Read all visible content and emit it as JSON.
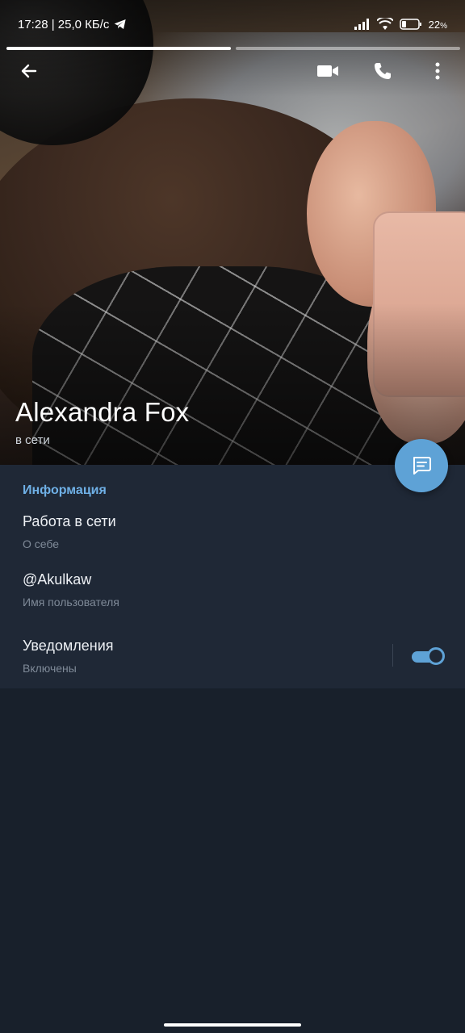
{
  "status_bar": {
    "time_speed": "17:28 | 25,0 КБ/с",
    "battery": "22",
    "battery_unit": "%",
    "signal_icon": "signal-icon",
    "wifi_icon": "wifi-icon",
    "battery_icon": "battery-icon",
    "telegram_icon": "telegram-icon"
  },
  "story_progress": {
    "segments": 2,
    "active_index": 0
  },
  "top_bar": {
    "back_icon": "back-arrow-icon",
    "video_icon": "video-call-icon",
    "call_icon": "phone-call-icon",
    "menu_icon": "more-vertical-icon"
  },
  "profile": {
    "name": "Alexandra Fox",
    "status": "в сети"
  },
  "fab": {
    "icon": "message-icon"
  },
  "info": {
    "header": "Информация",
    "about": {
      "value": "Работа в сети",
      "label": "О себе"
    },
    "username": {
      "value": "@Akulkaw",
      "label": "Имя пользователя"
    },
    "notifications": {
      "value": "Уведомления",
      "label": "Включены",
      "enabled": true
    }
  },
  "colors": {
    "accent": "#5ea2d6",
    "header_accent": "#6fb0e6",
    "section_bg": "#1f2836",
    "page_bg": "#18202b"
  }
}
